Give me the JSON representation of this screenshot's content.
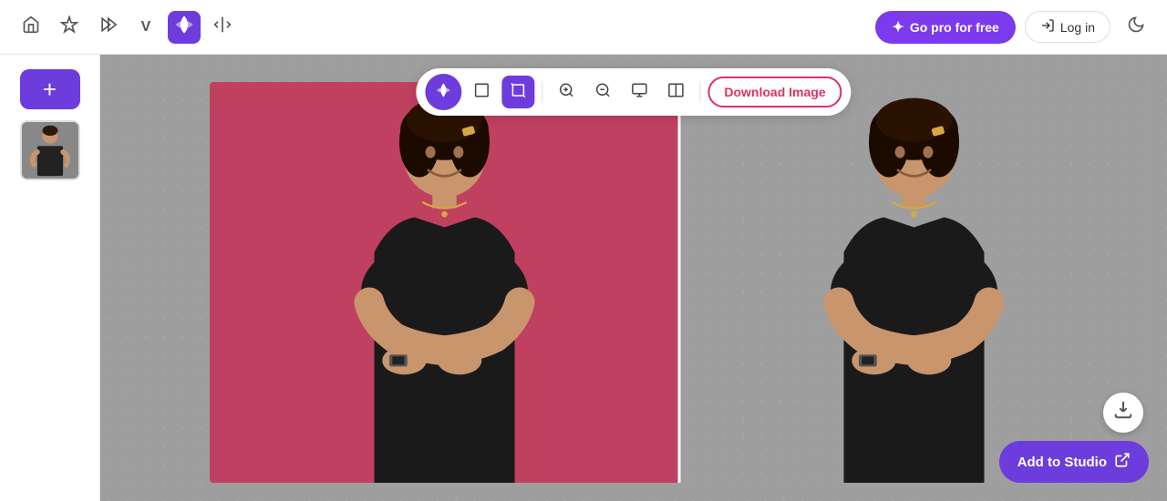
{
  "header": {
    "home_icon": "🏠",
    "sparkle_icon": "✦",
    "forward_icon": "⏭",
    "v_icon": "V",
    "brand_icon": "✿",
    "compare_icon": "⇄",
    "go_pro_label": "Go pro for free",
    "login_label": "Log in",
    "dark_mode_icon": "🌙"
  },
  "sidebar": {
    "add_label": "+",
    "thumb_alt": "Image thumbnail"
  },
  "toolbar": {
    "pen_icon": "✒",
    "rectangle_icon": "□",
    "crop_active_icon": "⊟",
    "zoom_in_icon": "⊕",
    "zoom_out_icon": "⊖",
    "compare_icon": "⧉",
    "split_icon": "⊞",
    "download_label": "Download Image"
  },
  "canvas": {
    "add_to_studio_label": "Add to Studio",
    "add_to_studio_icon": "↗"
  }
}
